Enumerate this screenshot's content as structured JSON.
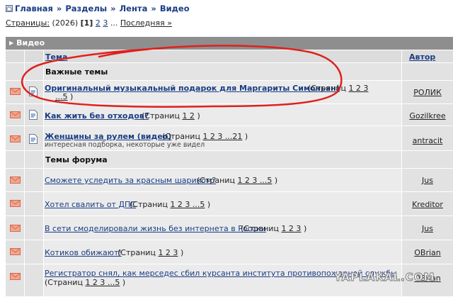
{
  "breadcrumb": {
    "items": [
      "Главная",
      "Разделы",
      "Лента",
      "Видео"
    ],
    "separator": "»"
  },
  "pagination": {
    "label": "Страницы:",
    "total": "(2026)",
    "current": "[1]",
    "pages": [
      "2",
      "3"
    ],
    "ellipsis": "...",
    "last": "Последняя »"
  },
  "category": {
    "title": "Видео"
  },
  "table": {
    "col_topic": "Тема",
    "col_author": "Автор"
  },
  "sections": {
    "important": "Важные темы",
    "forum": "Темы форума"
  },
  "topics": [
    {
      "title": "Оригинальный музыкальный подарок для Маргариты Симоньян!",
      "pages_prefix": "(Страниц",
      "pages": "1 2 3 ...5",
      "pages_suffix": ")",
      "author": "РОЛИК",
      "bold": true
    },
    {
      "title": "Как жить без отходов?",
      "pages_prefix": "(Страниц",
      "pages": "1 2",
      "pages_suffix": ")",
      "author": "Gozilkree",
      "bold": true
    },
    {
      "title": "Женщины за рулем (видео)",
      "pages_prefix": "(Страниц",
      "pages": "1 2 3 ...21",
      "pages_suffix": ")",
      "description": "интересная подборка, некоторые уже видел",
      "author": "antracit",
      "bold": true
    },
    {
      "title": "Сможете уследить за красным шариком?",
      "pages_prefix": "(Страниц",
      "pages": "1 2 3 ...5",
      "pages_suffix": ")",
      "author": "Jus",
      "bold": false
    },
    {
      "title": "Хотел свалить от ДПС",
      "pages_prefix": "(Страниц",
      "pages": "1 2 3 ...5",
      "pages_suffix": ")",
      "author": "Kreditor",
      "bold": false
    },
    {
      "title": "В сети смоделировали жизнь без интернета в России",
      "pages_prefix": "(Страниц",
      "pages": "1 2 3",
      "pages_suffix": ")",
      "author": "Jus",
      "bold": false
    },
    {
      "title": "Котиков обижают!",
      "pages_prefix": "(Страниц",
      "pages": "1 2 3",
      "pages_suffix": ")",
      "author": "OBrian",
      "bold": false
    },
    {
      "title": "Регистратор снял, как мерседес сбил курсанта института противопожарной службы",
      "pages_prefix": "(Страниц",
      "pages": "1 2 3 ...5",
      "pages_suffix": ")",
      "author": "OBrian",
      "bold": false
    }
  ],
  "watermark": "YAPLAKAL.COM",
  "colors": {
    "link": "#1a3d84",
    "category_bar": "#8e8e8e",
    "envelope": "#e8826a",
    "annotation": "#e0201c"
  },
  "icons": {
    "new_posts": "envelope-icon",
    "topic_doc": "document-icon",
    "category_arrow": "triangle-right-icon",
    "home": "home-icon"
  }
}
